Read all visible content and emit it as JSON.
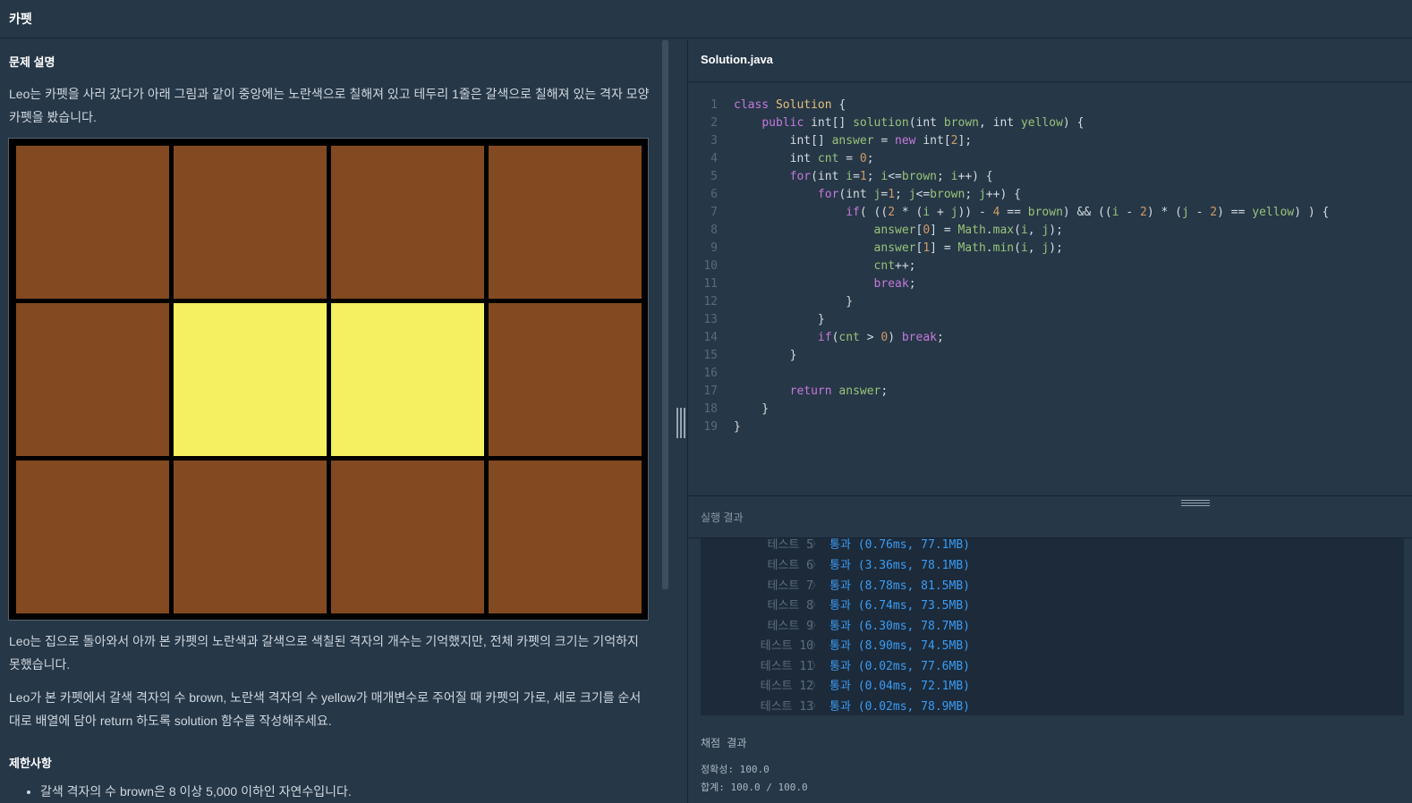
{
  "header": {
    "title": "카펫"
  },
  "problem": {
    "section_title": "문제 설명",
    "intro": "Leo는 카펫을 사러 갔다가 아래 그림과 같이 중앙에는 노란색으로 칠해져 있고 테두리 1줄은 갈색으로 칠해져 있는 격자 모양 카펫을 봤습니다.",
    "para2": "Leo는 집으로 돌아와서 아까 본 카펫의 노란색과 갈색으로 색칠된 격자의 개수는 기억했지만, 전체 카펫의 크기는 기억하지 못했습니다.",
    "para3": "Leo가 본 카펫에서 갈색 격자의 수 brown, 노란색 격자의 수 yellow가 매개변수로 주어질 때 카펫의 가로, 세로 크기를 순서대로 배열에 담아 return 하도록 solution 함수를 작성해주세요.",
    "constraints_title": "제한사항",
    "constraints": [
      "갈색 격자의 수 brown은 8 이상 5,000 이하인 자연수입니다."
    ],
    "colors": {
      "brown": "#834a21",
      "yellow": "#f3f061"
    },
    "grid": [
      [
        "brown",
        "brown",
        "brown",
        "brown"
      ],
      [
        "brown",
        "yellow",
        "yellow",
        "brown"
      ],
      [
        "brown",
        "brown",
        "brown",
        "brown"
      ]
    ]
  },
  "editor": {
    "filename": "Solution.java",
    "line_numbers": [
      "1",
      "2",
      "3",
      "4",
      "5",
      "6",
      "7",
      "8",
      "9",
      "10",
      "11",
      "12",
      "13",
      "14",
      "15",
      "16",
      "17",
      "18",
      "19"
    ]
  },
  "results": {
    "label": "실행 결과",
    "tests": [
      {
        "name": "테스트 5",
        "result": "통과 (0.76ms, 77.1MB)"
      },
      {
        "name": "테스트 6",
        "result": "통과 (3.36ms, 78.1MB)"
      },
      {
        "name": "테스트 7",
        "result": "통과 (8.78ms, 81.5MB)"
      },
      {
        "name": "테스트 8",
        "result": "통과 (6.74ms, 73.5MB)"
      },
      {
        "name": "테스트 9",
        "result": "통과 (6.30ms, 78.7MB)"
      },
      {
        "name": "테스트 10",
        "result": "통과 (8.90ms, 74.5MB)"
      },
      {
        "name": "테스트 11",
        "result": "통과 (0.02ms, 77.6MB)"
      },
      {
        "name": "테스트 12",
        "result": "통과 (0.04ms, 72.1MB)"
      },
      {
        "name": "테스트 13",
        "result": "통과 (0.02ms, 78.9MB)"
      }
    ],
    "grading_title": "채점 결과",
    "accuracy": "정확성: 100.0",
    "total": "합계: 100.0 / 100.0"
  }
}
